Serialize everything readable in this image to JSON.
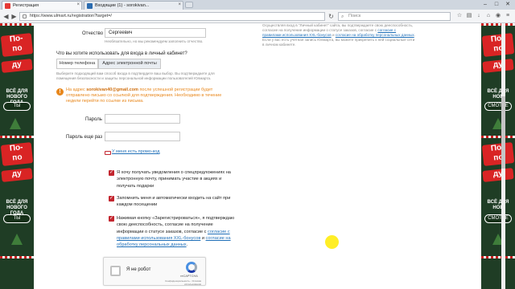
{
  "browser": {
    "tabs": [
      {
        "title": "Регистрация",
        "icon_color": "#e53935",
        "active": true
      },
      {
        "title": "Входящие (1) - sorokivan...",
        "icon_color": "#2b6cb0",
        "active": false
      }
    ],
    "url": "https://www.ulmart.ru/registration?target=/",
    "search_placeholder": "Поиск",
    "window_controls": [
      "–",
      "□",
      "✕"
    ]
  },
  "banner": {
    "headline_lines": [
      "По-",
      "по",
      "ду"
    ],
    "subtitle": "ВСЁ ДЛЯ НОВОГО ГОДА",
    "subtitle_right": "ВСЁ ДЛЯ НОВ",
    "left_pill": "ТЫ",
    "right_pill": "СМОТРЕ",
    "red": "#d92424",
    "green": "#1f3d25"
  },
  "right_note": {
    "text": "Осуществляя вход в \"Личный кабинет\" сайта, вы подтверждаете свою дееспособность, согласие на получение информации о статусе заказов, согласие с",
    "link1": "согласие с правилами использования XXL-бонусов",
    "mid": " и",
    "link2": "согласие на обработку персональных данных",
    "tail": ". Если у вас есть учетная запись Юлмарта, вы можете прикрепить к ней социальные сети в личном кабинете."
  },
  "form": {
    "patronymic_label": "Отчество",
    "patronymic_value": "Сергеевич",
    "patronymic_hint": "Необязательно, но мы рекомендуем заполнить отчество.",
    "login_question": "Что вы хотите использовать для входа в личный кабинет?",
    "login_options": [
      "Номер телефона",
      "Адрес электронной почты"
    ],
    "login_hint": "Выберите подходящий вам способ входа в подтвердите ваш выбор. Вы подтверждаете для помещения безопасности и защиты персональной информации пользователей Юлмарта.",
    "notice_prefix": "На адрес",
    "notice_email": "sorokivan40@gmail.com",
    "notice_text": "после успешной регистрации будет отправлено письмо со ссылкой для подтверждения. Необходимо в течение недели перейти по ссылке из письма.",
    "password_label": "Пароль",
    "password_repeat_label": "Пароль еще раз",
    "promo_link": "У меня есть промо-код",
    "checkboxes": [
      {
        "text": "Я хочу получать уведомления о спецпредложениях на электронную почту, принимать участие в акциях и получать подарки",
        "checked": true
      },
      {
        "text": "Запомнить меня и автоматически входить на сайт при каждом посещении",
        "checked": true
      },
      {
        "text": "Нажимая кнопку «Зарегистрироваться», я подтверждаю свою дееспособность, согласие на получение информации о статусе заказов, согласие с",
        "link1": "согласие с правилами использования XXL-бонусов",
        "mid": " и ",
        "link2": "согласие на обработку персональных данных",
        "tail": ".",
        "checked": true
      }
    ]
  },
  "captcha": {
    "label": "Я не робот",
    "brand": "reCAPTCHA",
    "sub": "Конфиденциальность - Условия использования"
  },
  "colors": {
    "accent_red": "#c3262f",
    "warning_orange": "#e8871c",
    "link_blue": "#1f6fb8"
  }
}
